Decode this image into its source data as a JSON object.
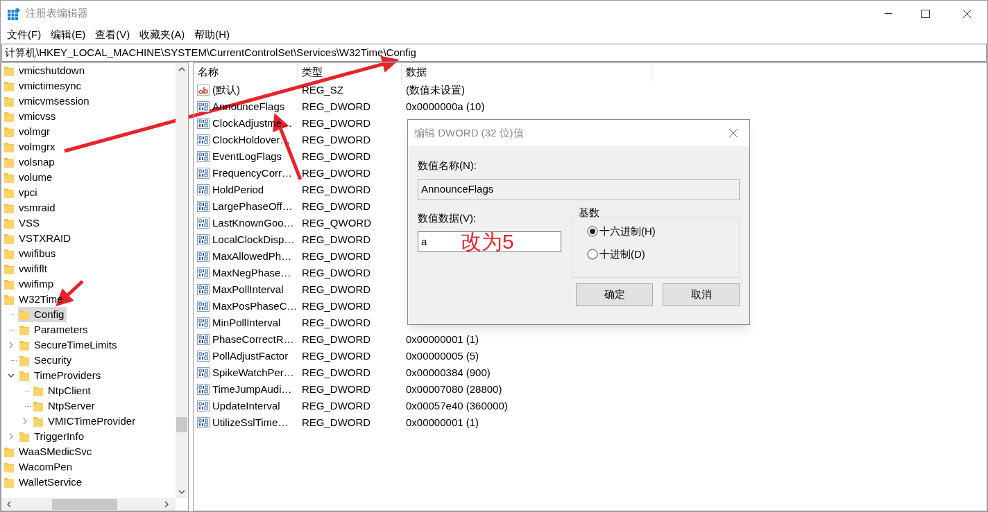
{
  "window": {
    "title": "注册表编辑器"
  },
  "menu": [
    "文件(F)",
    "编辑(E)",
    "查看(V)",
    "收藏夹(A)",
    "帮助(H)"
  ],
  "address": "计算机\\HKEY_LOCAL_MACHINE\\SYSTEM\\CurrentControlSet\\Services\\W32Time\\Config",
  "tree": {
    "items": [
      {
        "label": "vmicshutdown",
        "selected": false
      },
      {
        "label": "vmictimesync",
        "selected": false
      },
      {
        "label": "vmicvmsession",
        "selected": false
      },
      {
        "label": "vmicvss",
        "selected": false
      },
      {
        "label": "volmgr",
        "selected": false
      },
      {
        "label": "volmgrx",
        "selected": false
      },
      {
        "label": "volsnap",
        "selected": false
      },
      {
        "label": "volume",
        "selected": false
      },
      {
        "label": "vpci",
        "selected": false
      },
      {
        "label": "vsmraid",
        "selected": false
      },
      {
        "label": "VSS",
        "selected": false
      },
      {
        "label": "VSTXRAID",
        "selected": false
      },
      {
        "label": "vwifibus",
        "selected": false
      },
      {
        "label": "vwififlt",
        "selected": false
      },
      {
        "label": "vwifimp",
        "selected": false
      },
      {
        "label": "W32Time",
        "selected": false,
        "children": [
          {
            "label": "Config",
            "selected": true
          },
          {
            "label": "Parameters",
            "selected": false
          },
          {
            "label": "SecureTimeLimits",
            "selected": false,
            "expanded": false
          },
          {
            "label": "Security",
            "selected": false
          },
          {
            "label": "TimeProviders",
            "selected": false,
            "expanded": true,
            "children": [
              {
                "label": "NtpClient",
                "selected": false
              },
              {
                "label": "NtpServer",
                "selected": false
              },
              {
                "label": "VMICTimeProvider",
                "selected": false,
                "expanded": false
              }
            ]
          },
          {
            "label": "TriggerInfo",
            "selected": false,
            "expanded": false
          }
        ]
      },
      {
        "label": "WaaSMedicSvc",
        "selected": false
      },
      {
        "label": "WacomPen",
        "selected": false
      },
      {
        "label": "WalletService",
        "selected": false
      }
    ]
  },
  "table": {
    "columns": [
      "名称",
      "类型",
      "数据"
    ],
    "rows": [
      {
        "kind": "string",
        "name": "(默认)",
        "type": "REG_SZ",
        "data": "(数值未设置)"
      },
      {
        "kind": "number",
        "name": "AnnounceFlags",
        "type": "REG_DWORD",
        "data": "0x0000000a (10)"
      },
      {
        "kind": "number",
        "name": "ClockAdjustme…",
        "type": "REG_DWORD"
      },
      {
        "kind": "number",
        "name": "ClockHoldover…",
        "type": "REG_DWORD"
      },
      {
        "kind": "number",
        "name": "EventLogFlags",
        "type": "REG_DWORD"
      },
      {
        "kind": "number",
        "name": "FrequencyCorr…",
        "type": "REG_DWORD"
      },
      {
        "kind": "number",
        "name": "HoldPeriod",
        "type": "REG_DWORD"
      },
      {
        "kind": "number",
        "name": "LargePhaseOff…",
        "type": "REG_DWORD"
      },
      {
        "kind": "number",
        "name": "LastKnownGoo…",
        "type": "REG_QWORD"
      },
      {
        "kind": "number",
        "name": "LocalClockDisp…",
        "type": "REG_DWORD"
      },
      {
        "kind": "number",
        "name": "MaxAllowedPh…",
        "type": "REG_DWORD"
      },
      {
        "kind": "number",
        "name": "MaxNegPhase…",
        "type": "REG_DWORD"
      },
      {
        "kind": "number",
        "name": "MaxPollInterval",
        "type": "REG_DWORD"
      },
      {
        "kind": "number",
        "name": "MaxPosPhaseC…",
        "type": "REG_DWORD"
      },
      {
        "kind": "number",
        "name": "MinPollInterval",
        "type": "REG_DWORD"
      },
      {
        "kind": "number",
        "name": "PhaseCorrectR…",
        "type": "REG_DWORD",
        "data": "0x00000001 (1)"
      },
      {
        "kind": "number",
        "name": "PollAdjustFactor",
        "type": "REG_DWORD",
        "data": "0x00000005 (5)"
      },
      {
        "kind": "number",
        "name": "SpikeWatchPer…",
        "type": "REG_DWORD",
        "data": "0x00000384 (900)"
      },
      {
        "kind": "number",
        "name": "TimeJumpAudi…",
        "type": "REG_DWORD",
        "data": "0x00007080 (28800)"
      },
      {
        "kind": "number",
        "name": "UpdateInterval",
        "type": "REG_DWORD",
        "data": "0x00057e40 (360000)"
      },
      {
        "kind": "number",
        "name": "UtilizeSslTime…",
        "type": "REG_DWORD",
        "data": "0x00000001 (1)"
      }
    ]
  },
  "dialog": {
    "title": "编辑 DWORD (32 位)值",
    "name_label": "数值名称(N):",
    "name_value": "AnnounceFlags",
    "data_label": "数值数据(V):",
    "data_value": "a",
    "note": "改为5",
    "base_label": "基数",
    "bases": [
      {
        "label": "十六进制(H)",
        "selected": true
      },
      {
        "label": "十进制(D)",
        "selected": false
      }
    ],
    "buttons": [
      "确定",
      "取消"
    ]
  }
}
